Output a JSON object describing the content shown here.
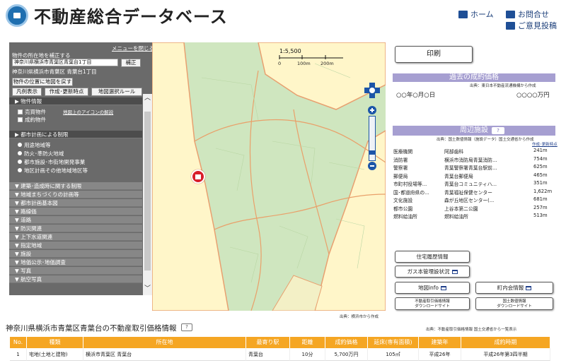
{
  "header": {
    "title": "不動産総合データベース",
    "home": "ホーム",
    "contact": "お問合せ",
    "feedback": "ご意見投稿"
  },
  "left_panel": {
    "close_menu": "メニューを閉じる",
    "correct_prompt": "物件の所在地を補正する",
    "address_value": "神奈川県横浜市青葉区青葉台1丁目",
    "correct_button": "補正",
    "address_display": "神奈川県横浜市青葉区 青葉台1丁目",
    "return_button": "物件の位置に地図を戻す",
    "legend_button": "凡例表示",
    "update_button": "作成･更新時点",
    "map_rule_button": "地図選択ルール",
    "section_property": "▶ 物件情報",
    "opt_for_sale": "売買物件",
    "opt_icon_explain": "地図上のアイコンの解説",
    "opt_sold": "成約物件",
    "section_urban": "▶ 都市計画による制限",
    "radio_1": "用途地域等",
    "radio_2": "防火･準防火地域",
    "radio_3": "都市施設･市街地開発事業",
    "radio_4": "地区計画その他地域地区等",
    "sections": [
      "▼ 建築･造成時に関する制限",
      "▼ 地域まちづくりの計画等",
      "▼ 都市計画基本図",
      "▼ 路線価",
      "▼ 道路",
      "▼ 防災関連",
      "▼ 上下水道関連",
      "▼ 指定地域",
      "▼ 施設",
      "▼ 地価公示･地価調査",
      "▼ 写真",
      "▼ 航空写真"
    ]
  },
  "map": {
    "scale": "1:5,500",
    "scale_0": "0",
    "scale_100": "100m",
    "scale_200": "200m",
    "source": "出典：横浜市から作成"
  },
  "right": {
    "print": "印刷",
    "past_price_head": "過去の成約価格",
    "past_price_src": "出典：東日本不動産流通機構から作成",
    "past_date": "○○年○月○日",
    "past_price": "○○○○万円",
    "nearby_head": "周辺施設",
    "nearby_src": "出典：国土数値情報（施設データ）国土交通省から作成",
    "nearby_link": "作成･更新時点",
    "facilities": [
      {
        "type": "医療機関",
        "name": "阿部歯科",
        "dist": "241m"
      },
      {
        "type": "消防署",
        "name": "横浜市消防局青葉消防...",
        "dist": "754m"
      },
      {
        "type": "警察署",
        "name": "青葉警察署青葉台駅前...",
        "dist": "625m"
      },
      {
        "type": "郵便局",
        "name": "青葉台郵便局",
        "dist": "465m"
      },
      {
        "type": "市町村役場等...",
        "name": "青葉台コミュニティハ...",
        "dist": "351m"
      },
      {
        "type": "国･都道府県の...",
        "name": "青葉福祉保健センター",
        "dist": "1,622m"
      },
      {
        "type": "文化施設",
        "name": "森が丘地区センター(...",
        "dist": "681m"
      },
      {
        "type": "都市公園",
        "name": "上谷本第二公園",
        "dist": "257m"
      },
      {
        "type": "燃料給油所",
        "name": "燃料給油所",
        "dist": "513m"
      }
    ],
    "btn_housing": "住宅履歴情報",
    "btn_gas": "ガス本管埋設状況",
    "btn_mapinfo": "地図info",
    "btn_community": "町内会情報",
    "btn_trade1_l1": "不動産取引価格情報",
    "btn_trade1_l2": "ダウンロードサイト",
    "btn_trade2_l1": "国土数値情報",
    "btn_trade2_l2": "ダウンロードサイト"
  },
  "table": {
    "title": "神奈川県横浜市青葉区青葉台の不動産取引価格情報",
    "help": "?",
    "source": "出典：不動産取引価格情報 国土交通省から一覧表示",
    "headers": [
      "No.",
      "種類",
      "所在地",
      "最寄り駅",
      "距離",
      "成約価格",
      "延床(専有面積)",
      "建築年",
      "成約時期"
    ],
    "rows": [
      [
        "1",
        "宅地(土地と建物)",
        "横浜市青葉区 青葉台",
        "青葉台",
        "10分",
        "5,700万円",
        "105㎡",
        "平成26年",
        "平成26年第3四半期"
      ]
    ]
  },
  "colors": {
    "accent": "#1f4f96",
    "header_band": "#a69fd1",
    "table_head": "#f5a623",
    "map_green": "#cfe6bf",
    "map_yellow": "#fff6c9"
  }
}
